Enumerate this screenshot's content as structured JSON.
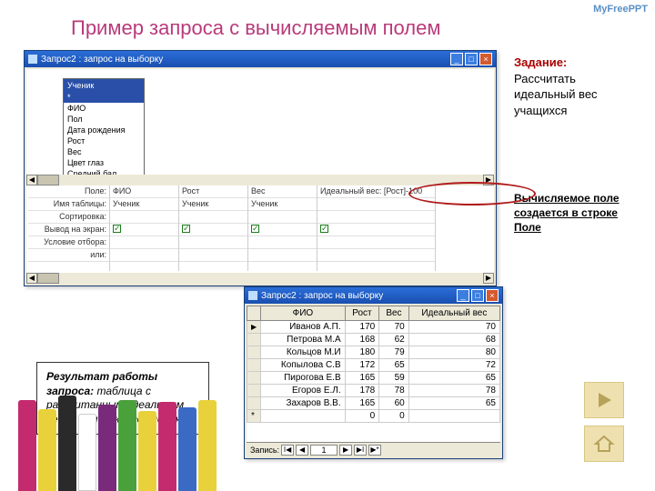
{
  "watermark": "MyFreePPT",
  "slide_title": "Пример  запроса с вычисляемым полем",
  "task": {
    "header": "Задание:",
    "body": "Рассчитать идеальный вес учащихся"
  },
  "note": "Вычисляемое поле создается в строке Поле",
  "win1": {
    "title": "Запрос2 : запрос на выборку",
    "table": {
      "name": "Ученик",
      "fields": [
        "*",
        "ФИО",
        "Пол",
        "Дата рождения",
        "Рост",
        "Вес",
        "Цвет глаз",
        "Средний бал"
      ]
    },
    "grid_labels": [
      "Поле:",
      "Имя таблицы:",
      "Сортировка:",
      "Вывод на экран:",
      "Условие отбора:",
      "или:"
    ],
    "cols": [
      {
        "field": "ФИО",
        "table": "Ученик",
        "show": true
      },
      {
        "field": "Рост",
        "table": "Ученик",
        "show": true
      },
      {
        "field": "Вес",
        "table": "Ученик",
        "show": true
      },
      {
        "field": "Идеальный вес: [Рост]-100",
        "table": "",
        "show": true
      }
    ]
  },
  "win2": {
    "title": "Запрос2 : запрос на выборку",
    "headers": [
      "ФИО",
      "Рост",
      "Вес",
      "Идеальный вес"
    ],
    "rows": [
      [
        "Иванов А.П.",
        170,
        70,
        70
      ],
      [
        "Петрова М.А",
        168,
        62,
        68
      ],
      [
        "Кольцов М.И",
        180,
        79,
        80
      ],
      [
        "Копылова С.В",
        172,
        65,
        72
      ],
      [
        "Пирогова Е.В",
        165,
        59,
        65
      ],
      [
        "Егоров Е.Л.",
        178,
        78,
        78
      ],
      [
        "Захаров В.В.",
        165,
        60,
        65
      ]
    ],
    "newrow_label": "*",
    "nav_label": "Запись:",
    "nav_pos": "1"
  },
  "callout": {
    "lead": "Результат работы запроса:",
    "rest": " таблица с рассчитанным идеальным весом для каждого ученика"
  }
}
